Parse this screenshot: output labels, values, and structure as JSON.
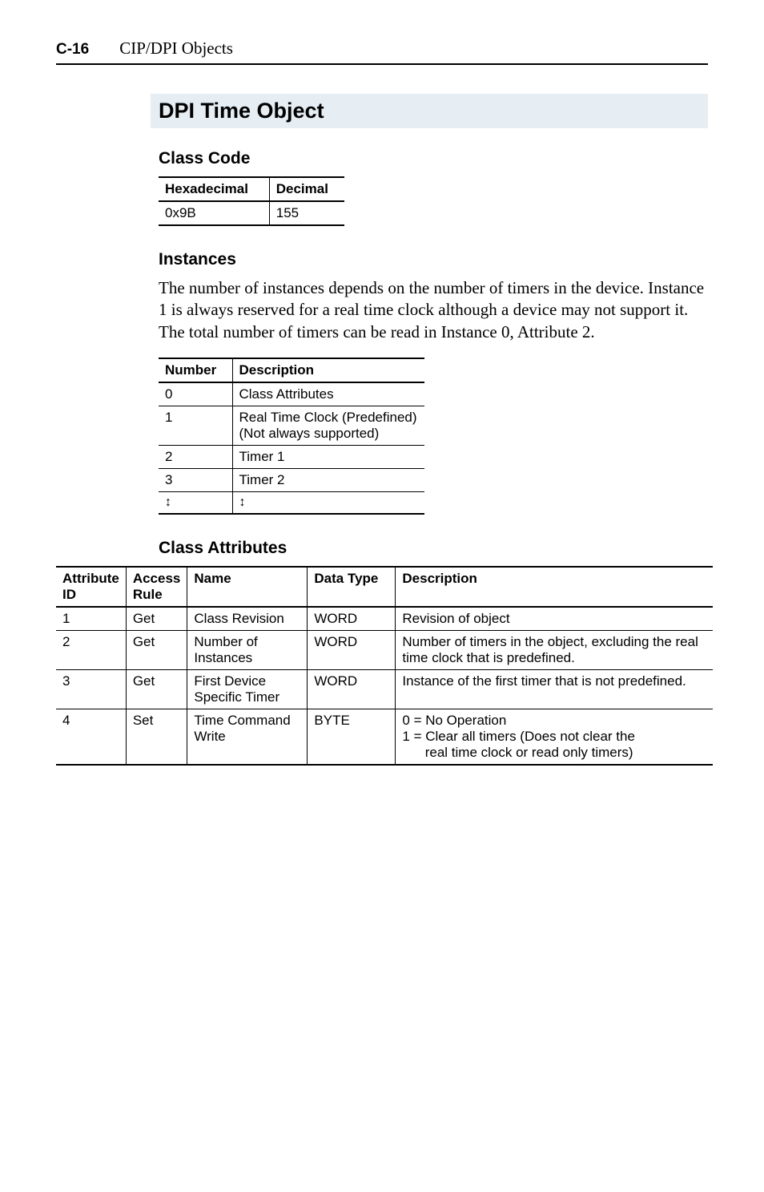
{
  "header": {
    "page_number": "C-16",
    "page_title": "CIP/DPI Objects"
  },
  "section": {
    "title": "DPI Time Object",
    "class_code": {
      "heading": "Class Code",
      "cols": [
        "Hexadecimal",
        "Decimal"
      ],
      "rows": [
        {
          "hex": "0x9B",
          "dec": "155"
        }
      ]
    },
    "instances": {
      "heading": "Instances",
      "paragraph": "The number of instances depends on the number of timers in the device. Instance 1 is always reserved for a real time clock although a device may not support it. The total number of timers can be read in Instance 0, Attribute 2.",
      "cols": [
        "Number",
        "Description"
      ],
      "rows": [
        {
          "num": "0",
          "desc": "Class Attributes"
        },
        {
          "num": "1",
          "desc": "Real Time Clock (Predefined)\n(Not always supported)"
        },
        {
          "num": "2",
          "desc": "Timer 1"
        },
        {
          "num": "3",
          "desc": "Timer 2"
        },
        {
          "num": "↕",
          "desc": "↕"
        }
      ]
    },
    "class_attributes": {
      "heading": "Class Attributes",
      "cols": [
        "Attribute ID",
        "Access Rule",
        "Name",
        "Data Type",
        "Description"
      ],
      "rows": [
        {
          "id": "1",
          "rule": "Get",
          "name": "Class Revision",
          "dtype": "WORD",
          "desc": "Revision of object"
        },
        {
          "id": "2",
          "rule": "Get",
          "name": "Number of Instances",
          "dtype": "WORD",
          "desc": "Number of timers in the object, excluding the real time clock that is predefined."
        },
        {
          "id": "3",
          "rule": "Get",
          "name": "First Device Specific Timer",
          "dtype": "WORD",
          "desc": "Instance of the first timer that is not predefined."
        },
        {
          "id": "4",
          "rule": "Set",
          "name": "Time Command Write",
          "dtype": "BYTE",
          "desc": "0 = No Operation\n1 = Clear all timers (Does not clear the\n      real time clock or read only timers)"
        }
      ]
    }
  }
}
